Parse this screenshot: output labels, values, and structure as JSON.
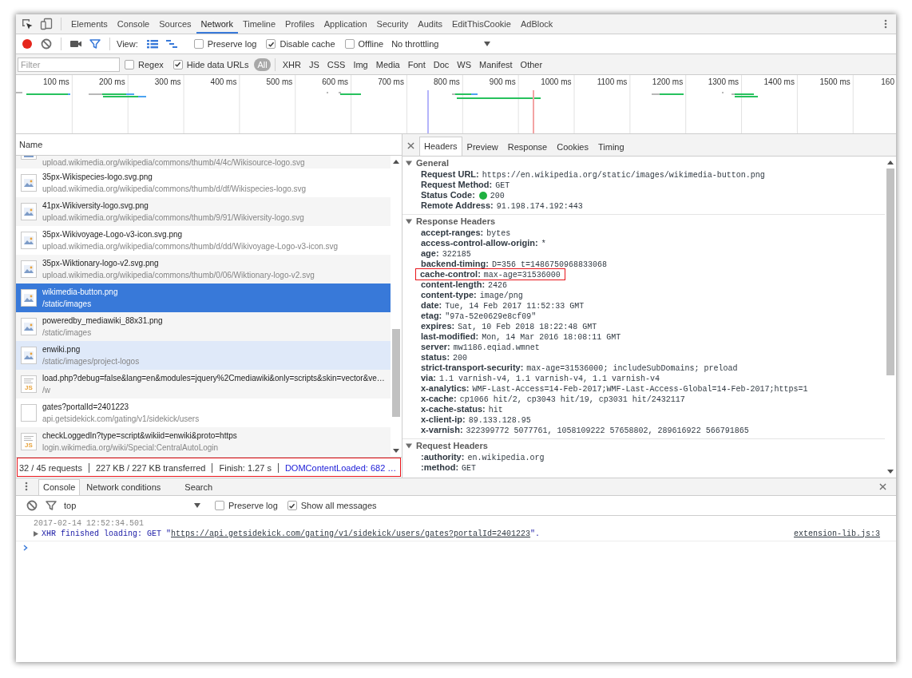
{
  "tabs": [
    {
      "label": "Elements",
      "selected": false
    },
    {
      "label": "Console",
      "selected": false
    },
    {
      "label": "Sources",
      "selected": false
    },
    {
      "label": "Network",
      "selected": true
    },
    {
      "label": "Timeline",
      "selected": false
    },
    {
      "label": "Profiles",
      "selected": false
    },
    {
      "label": "Application",
      "selected": false
    },
    {
      "label": "Security",
      "selected": false
    },
    {
      "label": "Audits",
      "selected": false
    },
    {
      "label": "EditThisCookie",
      "selected": false
    },
    {
      "label": "AdBlock",
      "selected": false
    }
  ],
  "network_toolbar": {
    "tool_groups": [
      [
        {
          "kind": "record",
          "on": true
        },
        {
          "kind": "clear"
        }
      ],
      [
        {
          "kind": "camera",
          "on": false
        },
        {
          "kind": "filter",
          "on": true
        }
      ]
    ],
    "view_label": "View:",
    "view_toggles": [
      {
        "kind": "large-rows",
        "on": true
      },
      {
        "kind": "overview",
        "on": true
      }
    ],
    "options": [
      {
        "label": "Preserve log",
        "checked": false
      },
      {
        "label": "Disable cache",
        "checked": true
      },
      {
        "label": "Offline",
        "checked": false
      }
    ],
    "throttling": "No throttling"
  },
  "filter_bar": {
    "placeholder": "Filter",
    "options": [
      {
        "label": "Regex",
        "checked": false
      },
      {
        "label": "Hide data URLs",
        "checked": true
      }
    ],
    "types": [
      {
        "label": "All",
        "selected": true
      },
      {
        "label": "XHR",
        "selected": false
      },
      {
        "label": "JS",
        "selected": false
      },
      {
        "label": "CSS",
        "selected": false
      },
      {
        "label": "Img",
        "selected": false
      },
      {
        "label": "Media",
        "selected": false
      },
      {
        "label": "Font",
        "selected": false
      },
      {
        "label": "Doc",
        "selected": false
      },
      {
        "label": "WS",
        "selected": false
      },
      {
        "label": "Manifest",
        "selected": false
      },
      {
        "label": "Other",
        "selected": false
      }
    ]
  },
  "overview": {
    "ticks": [
      "100 ms",
      "200 ms",
      "300 ms",
      "400 ms",
      "500 ms",
      "600 ms",
      "700 ms",
      "800 ms",
      "900 ms",
      "1000 ms",
      "1100 ms",
      "1200 ms",
      "1300 ms",
      "1400 ms",
      "1500 ms",
      "160"
    ]
  },
  "request_list": {
    "column": "Name",
    "rows": [
      {
        "kind": "image",
        "url": "upload.wikimedia.org/wikipedia/commons/thumb/4/4c/Wikisource-logo.svg",
        "selected": false,
        "hovered": false
      },
      {
        "kind": "image",
        "name": "35px-Wikispecies-logo.svg.png",
        "url": "upload.wikimedia.org/wikipedia/commons/thumb/d/df/Wikispecies-logo.svg",
        "selected": false,
        "hovered": false
      },
      {
        "kind": "image",
        "name": "41px-Wikiversity-logo.svg.png",
        "url": "upload.wikimedia.org/wikipedia/commons/thumb/9/91/Wikiversity-logo.svg",
        "selected": false,
        "hovered": false
      },
      {
        "kind": "image",
        "name": "35px-Wikivoyage-Logo-v3-icon.svg.png",
        "url": "upload.wikimedia.org/wikipedia/commons/thumb/d/dd/Wikivoyage-Logo-v3-icon.svg",
        "selected": false,
        "hovered": false
      },
      {
        "kind": "image",
        "name": "35px-Wiktionary-logo-v2.svg.png",
        "url": "upload.wikimedia.org/wikipedia/commons/thumb/0/06/Wiktionary-logo-v2.svg",
        "selected": false,
        "hovered": false
      },
      {
        "kind": "image",
        "name": "wikimedia-button.png",
        "url": "/static/images",
        "selected": true,
        "hovered": false
      },
      {
        "kind": "image",
        "name": "poweredby_mediawiki_88x31.png",
        "url": "/static/images",
        "selected": false,
        "hovered": false
      },
      {
        "kind": "image",
        "name": "enwiki.png",
        "url": "/static/images/project-logos",
        "selected": false,
        "hovered": true
      },
      {
        "kind": "script",
        "badge": "JS",
        "name": "load.php?debug=false&lang=en&modules=jquery%2Cmediawiki&only=scripts&skin=vector&ve…",
        "url": "/w",
        "selected": false,
        "hovered": false
      },
      {
        "kind": "blank",
        "name": "gates?portalId=2401223",
        "url": "api.getsidekick.com/gating/v1/sidekick/users",
        "selected": false,
        "hovered": false
      },
      {
        "kind": "script",
        "badge": "JS",
        "name": "checkLoggedIn?type=script&wikiid=enwiki&proto=https",
        "url": "login.wikimedia.org/wiki/Special:CentralAutoLogin",
        "selected": false,
        "hovered": false
      }
    ],
    "summary": {
      "highlighted": true,
      "items": [
        {
          "kind": "count",
          "text": "32 / 45 requests"
        },
        {
          "kind": "size",
          "text": "227 KB / 227 KB transferred"
        },
        {
          "kind": "finish",
          "text": "Finish: 1.27 s"
        },
        {
          "kind": "dom",
          "text": "DOMContentLoaded: 682 …"
        }
      ]
    }
  },
  "details": {
    "tabs": [
      {
        "label": "Headers",
        "selected": true
      },
      {
        "label": "Preview",
        "selected": false
      },
      {
        "label": "Response",
        "selected": false
      },
      {
        "label": "Cookies",
        "selected": false
      },
      {
        "label": "Timing",
        "selected": false
      }
    ],
    "sections": [
      {
        "title": "General",
        "expanded": true,
        "rows": [
          {
            "key": "Request URL:",
            "value": "https://en.wikipedia.org/static/images/wikimedia-button.png",
            "highlighted": false
          },
          {
            "key": "Request Method:",
            "value": "GET",
            "highlighted": false
          },
          {
            "key": "Status Code:",
            "value": "200",
            "color": "#1fb141",
            "highlighted": false
          },
          {
            "key": "Remote Address:",
            "value": "91.198.174.192:443",
            "highlighted": false
          }
        ]
      },
      {
        "title": "Response Headers",
        "expanded": true,
        "rows": [
          {
            "key": "accept-ranges:",
            "value": "bytes",
            "highlighted": false
          },
          {
            "key": "access-control-allow-origin:",
            "value": "*",
            "highlighted": false
          },
          {
            "key": "age:",
            "value": "322185",
            "highlighted": false
          },
          {
            "key": "backend-timing:",
            "value": "D=356 t=1486750968833068",
            "highlighted": false
          },
          {
            "key": "cache-control:",
            "value": "max-age=31536000",
            "highlighted": true
          },
          {
            "key": "content-length:",
            "value": "2426",
            "highlighted": false
          },
          {
            "key": "content-type:",
            "value": "image/png",
            "highlighted": false
          },
          {
            "key": "date:",
            "value": "Tue, 14 Feb 2017 11:52:33 GMT",
            "highlighted": false
          },
          {
            "key": "etag:",
            "value": "\"97a-52e0629e8cf09\"",
            "highlighted": false
          },
          {
            "key": "expires:",
            "value": "Sat, 10 Feb 2018 18:22:48 GMT",
            "highlighted": false
          },
          {
            "key": "last-modified:",
            "value": "Mon, 14 Mar 2016 18:08:11 GMT",
            "highlighted": false
          },
          {
            "key": "server:",
            "value": "mw1186.eqiad.wmnet",
            "highlighted": false
          },
          {
            "key": "status:",
            "value": "200",
            "highlighted": false
          },
          {
            "key": "strict-transport-security:",
            "value": "max-age=31536000; includeSubDomains; preload",
            "highlighted": false
          },
          {
            "key": "via:",
            "value": "1.1 varnish-v4, 1.1 varnish-v4, 1.1 varnish-v4",
            "highlighted": false
          },
          {
            "key": "x-analytics:",
            "value": "WMF-Last-Access=14-Feb-2017;WMF-Last-Access-Global=14-Feb-2017;https=1",
            "highlighted": false
          },
          {
            "key": "x-cache:",
            "value": "cp1066 hit/2, cp3043 hit/19, cp3031 hit/2432117",
            "highlighted": false
          },
          {
            "key": "x-cache-status:",
            "value": "hit",
            "highlighted": false
          },
          {
            "key": "x-client-ip:",
            "value": "89.133.128.95",
            "highlighted": false
          },
          {
            "key": "x-varnish:",
            "value": "322399772 5077761, 1058109222 57658802, 289616922 566791865",
            "highlighted": false
          }
        ]
      },
      {
        "title": "Request Headers",
        "expanded": true,
        "rows": [
          {
            "key": ":authority:",
            "value": "en.wikipedia.org",
            "highlighted": false
          },
          {
            "key": ":method:",
            "value": "GET",
            "highlighted": false
          }
        ]
      }
    ]
  },
  "drawer": {
    "tabs": [
      {
        "label": "Console",
        "selected": true
      },
      {
        "label": "Network conditions",
        "selected": false
      },
      {
        "label": "Search",
        "selected": false
      }
    ],
    "context": "top",
    "options": [
      {
        "label": "Preserve log",
        "checked": false
      },
      {
        "label": "Show all messages",
        "checked": true
      }
    ],
    "messages": [
      {
        "timestamp": "2017-02-14 12:52:34.501",
        "expanded": false,
        "text": "XHR finished loading: GET \"",
        "url": "https://api.getsidekick.com/gating/v1/sidekick/users/gates?portalId=2401223",
        "text_after": "\".",
        "source": "extension-lib.js:3"
      }
    ]
  }
}
